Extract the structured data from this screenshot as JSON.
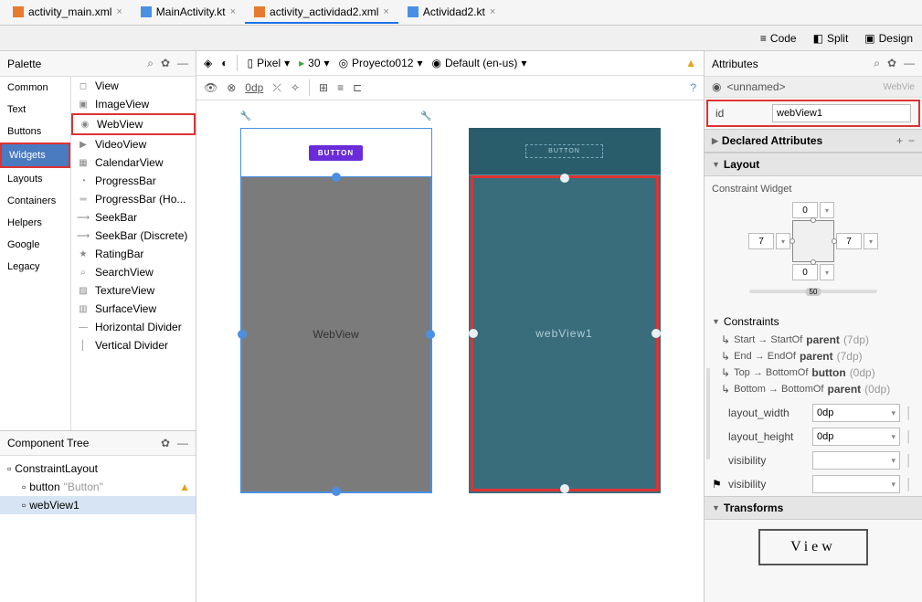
{
  "tabs": [
    {
      "label": "activity_main.xml",
      "icon": "xml"
    },
    {
      "label": "MainActivity.kt",
      "icon": "kt"
    },
    {
      "label": "activity_actividad2.xml",
      "icon": "xml",
      "active": true
    },
    {
      "label": "Actividad2.kt",
      "icon": "kt"
    }
  ],
  "modes": {
    "code": "Code",
    "split": "Split",
    "design": "Design"
  },
  "palette": {
    "title": "Palette",
    "categories": [
      "Common",
      "Text",
      "Buttons",
      "Widgets",
      "Layouts",
      "Containers",
      "Helpers",
      "Google",
      "Legacy"
    ],
    "selected_category": "Widgets",
    "widgets": [
      {
        "label": "View",
        "icon": "◻"
      },
      {
        "label": "ImageView",
        "icon": "▣"
      },
      {
        "label": "WebView",
        "icon": "◉",
        "hl": true
      },
      {
        "label": "VideoView",
        "icon": "▶"
      },
      {
        "label": "CalendarView",
        "icon": "▦"
      },
      {
        "label": "ProgressBar",
        "icon": "◔"
      },
      {
        "label": "ProgressBar (Ho...",
        "icon": "═"
      },
      {
        "label": "SeekBar",
        "icon": "⟶"
      },
      {
        "label": "SeekBar (Discrete)",
        "icon": "⟶"
      },
      {
        "label": "RatingBar",
        "icon": "★"
      },
      {
        "label": "SearchView",
        "icon": "⌕"
      },
      {
        "label": "TextureView",
        "icon": "▨"
      },
      {
        "label": "SurfaceView",
        "icon": "▥"
      },
      {
        "label": "Horizontal Divider",
        "icon": "—"
      },
      {
        "label": "Vertical Divider",
        "icon": "│"
      }
    ]
  },
  "tree": {
    "title": "Component Tree",
    "items": [
      {
        "label": "ConstraintLayout",
        "cls": "root",
        "indent": 0
      },
      {
        "label": "button",
        "extra": "\"Button\"",
        "cls": "btn",
        "indent": 1,
        "warn": true
      },
      {
        "label": "webView1",
        "cls": "web",
        "indent": 1,
        "sel": true
      }
    ]
  },
  "design_tb": {
    "device": "Pixel",
    "api": "30",
    "project": "Proyecto012",
    "locale": "Default (en-us)"
  },
  "sub_tb": {
    "zoom": "0dp"
  },
  "canvas": {
    "button_text": "BUTTON",
    "webview_text": "WebView",
    "blueprint_web": "webView1",
    "blueprint_btn": "BUTTON"
  },
  "attributes": {
    "title": "Attributes",
    "unnamed": "<unnamed>",
    "type": "WebVie",
    "id": {
      "label": "id",
      "value": "webView1"
    },
    "declared": "Declared Attributes",
    "layout": "Layout",
    "cw_title": "Constraint Widget",
    "cw": {
      "top": "0",
      "left": "7",
      "right": "7",
      "bottom": "0"
    },
    "constraints_h": "Constraints",
    "constraints": [
      {
        "side": "Start",
        "rel": "StartOf",
        "tgt": "parent",
        "m": "(7dp)"
      },
      {
        "side": "End",
        "rel": "EndOf",
        "tgt": "parent",
        "m": "(7dp)"
      },
      {
        "side": "Top",
        "rel": "BottomOf",
        "tgt": "button",
        "m": "(0dp)"
      },
      {
        "side": "Bottom",
        "rel": "BottomOf",
        "tgt": "parent",
        "m": "(0dp)"
      }
    ],
    "rows": [
      {
        "label": "layout_width",
        "value": "0dp"
      },
      {
        "label": "layout_height",
        "value": "0dp"
      },
      {
        "label": "visibility",
        "value": ""
      },
      {
        "label": "visibility",
        "value": "",
        "flag": true
      }
    ],
    "transforms": "Transforms",
    "transforms_preview": "View"
  }
}
